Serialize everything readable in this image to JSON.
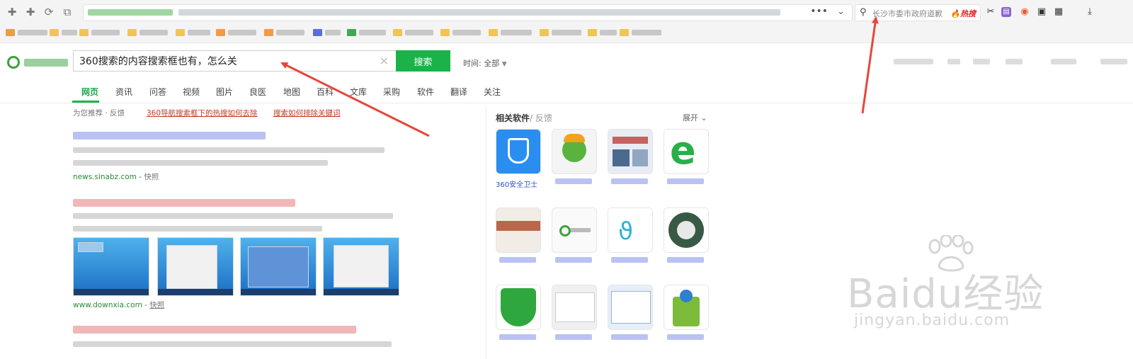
{
  "top_search": {
    "placeholder": "长沙市委市政府道歉",
    "hot_label": "热搜"
  },
  "search": {
    "query": "360搜索的内容搜索框也有，怎么关",
    "button_label": "搜索",
    "time_filter": "时间: 全部"
  },
  "tabs": [
    "网页",
    "资讯",
    "问答",
    "视频",
    "图片",
    "良医",
    "地图",
    "百科",
    "文库",
    "采购",
    "软件",
    "翻译",
    "关注"
  ],
  "recommend": {
    "label": "为您推荐 · 反馈",
    "links": [
      "360导航搜索框下的热搜如何去除",
      "搜索如何排除关键词"
    ]
  },
  "results": [
    {
      "source": "news.sinabz.com",
      "snapshot": "快照"
    },
    {
      "source": "www.downxia.com",
      "snapshot": "快照"
    }
  ],
  "right_panel": {
    "title": "相关软件",
    "subtitle": "/ 反馈",
    "expand": "展开",
    "apps": [
      "360安全卫士",
      "",
      "",
      "",
      "",
      "",
      "",
      "",
      "",
      "",
      "",
      ""
    ]
  },
  "watermark": {
    "text": "Baidu经验",
    "url": "jingyan.baidu.com"
  },
  "colors": {
    "accent": "#1ab349",
    "annotation_arrow": "#e8463a",
    "hot": "#e0261f",
    "result_link": "#b9c2f2"
  },
  "icons": [
    "back-icon",
    "forward-icon",
    "refresh-icon",
    "restore-icon",
    "search-icon",
    "scissors-icon",
    "extension-icon",
    "gamepad-icon",
    "screen-icon",
    "grid-icon",
    "download-icon",
    "clear-icon",
    "chevron-down-icon"
  ]
}
